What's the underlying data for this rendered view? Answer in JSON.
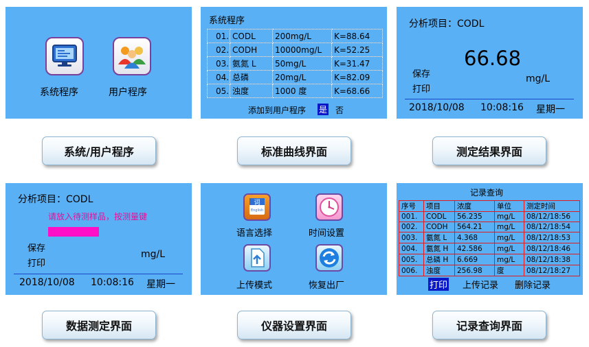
{
  "panel1": {
    "system_label": "系统程序",
    "user_label": "用户程序",
    "system_icon": "monitor-icon",
    "user_icon": "users-icon"
  },
  "panel2": {
    "title": "系统程序",
    "rows": [
      {
        "no": "01.",
        "name": "CODL",
        "range": "200mg/L",
        "k": "K=88.64"
      },
      {
        "no": "02.",
        "name": "CODH",
        "range": "10000mg/L",
        "k": "K=52.25"
      },
      {
        "no": "03.",
        "name": "氨氮 L",
        "range": "50mg/L",
        "k": "K=31.47"
      },
      {
        "no": "04.",
        "name": "总磷",
        "range": "20mg/L",
        "k": "K=82.09"
      },
      {
        "no": "05.",
        "name": "浊度",
        "range": "1000 度",
        "k": "K=68.66"
      }
    ],
    "add_prompt": "添加到用户程序",
    "yes": "是",
    "no": "否"
  },
  "panel3": {
    "item_label": "分析项目：CODL",
    "value": "66.68",
    "unit": "mg/L",
    "save": "保存",
    "print": "打印",
    "date": "2018/10/08",
    "time": "10:08:16",
    "weekday": "星期一"
  },
  "panel4": {
    "item_label": "分析项目：CODL",
    "prompt": "请放入待测样品，按测量键",
    "unit": "mg/L",
    "save": "保存",
    "print": "打印",
    "date": "2018/10/08",
    "time": "10:08:16",
    "weekday": "星期一",
    "prompt_color": "#e5119a",
    "bar_color": "#ff10c8"
  },
  "panel5": {
    "language": "语言选择",
    "time_setting": "时间设置",
    "upload_mode": "上传模式",
    "factory_reset": "恢复出厂",
    "language_icon_text": "词",
    "language_icon_sub": "English",
    "icons": [
      "dictionary-icon",
      "clock-icon",
      "upload-document-icon",
      "refresh-icon"
    ]
  },
  "panel6": {
    "title": "记录查询",
    "headers": [
      "序号",
      "项目",
      "浓度",
      "单位",
      "测定时间"
    ],
    "rows": [
      [
        "001.",
        "CODL",
        "56.235",
        "mg/L",
        "08/12/18:56"
      ],
      [
        "002.",
        "CODH",
        "564.21",
        "mg/L",
        "08/12/18:54"
      ],
      [
        "003.",
        "氨氮 L",
        "4.368",
        "mg/L",
        "08/12/18:53"
      ],
      [
        "004.",
        "氨氮 H",
        "42.586",
        "mg/L",
        "08/12/18:46"
      ],
      [
        "005.",
        "总磷 H",
        "6.669",
        "mg/L",
        "08/12/18:38"
      ],
      [
        "006.",
        "浊度",
        "256.98",
        "度",
        "08/12/18:27"
      ]
    ],
    "print": "打印",
    "upload": "上传记录",
    "delete": "删除记录"
  },
  "captions": {
    "c1": "系统/用户程序",
    "c2": "标准曲线界面",
    "c3": "测定结果界面",
    "c4": "数据测定界面",
    "c5": "仪器设置界面",
    "c6": "记录查询界面"
  },
  "colors": {
    "screen_bg": "#5ab0f4",
    "selection": "#0b18c8",
    "table_border": "#e01b1b",
    "divider": "#1a47c9"
  }
}
